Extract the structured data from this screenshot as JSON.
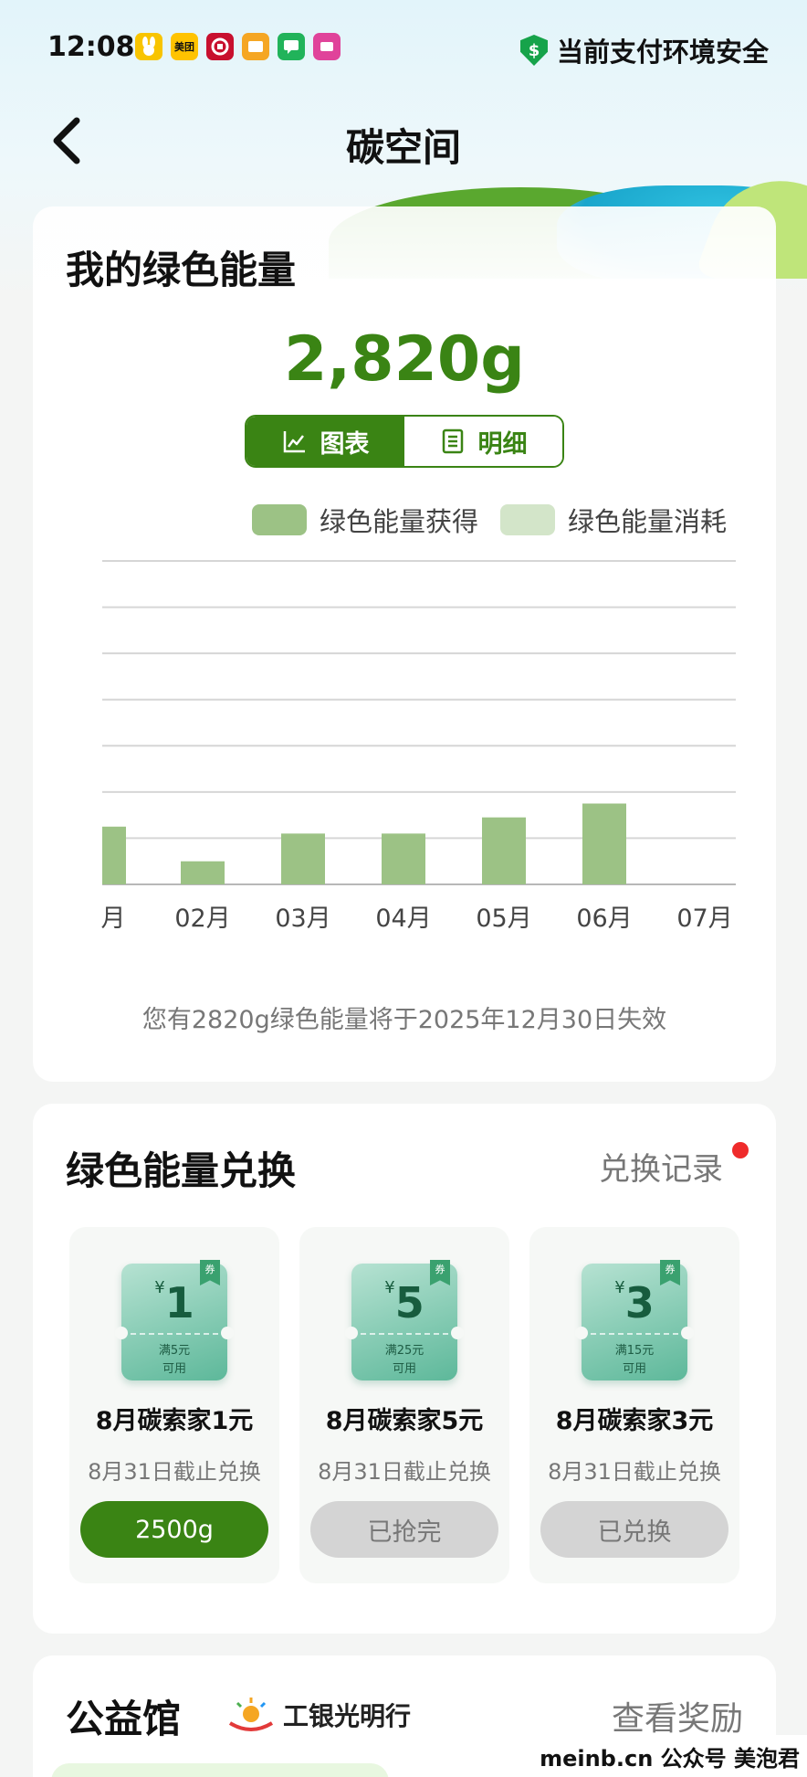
{
  "status_bar": {
    "time": "12:08",
    "app_icons": [
      {
        "name": "yellow-bunny-app-icon",
        "label": "",
        "color": "#f8c400"
      },
      {
        "name": "meituan-app-icon",
        "label": "美团",
        "color": "#ffc300"
      },
      {
        "name": "bank-app-icon",
        "label": "",
        "color": "#c8102e"
      },
      {
        "name": "orange-app-icon",
        "label": "",
        "color": "#f5a623"
      },
      {
        "name": "message-app-icon",
        "label": "",
        "color": "#21b35a"
      },
      {
        "name": "pink-app-icon",
        "label": "",
        "color": "#e0439a"
      }
    ],
    "security_text": "当前支付环境安全",
    "security_icon": "shield-dollar-icon"
  },
  "nav": {
    "title": "碳空间",
    "back_icon": "chevron-left-icon"
  },
  "energy_card": {
    "title": "我的绿色能量",
    "total": "2,820g",
    "tabs": [
      {
        "label": "图表",
        "icon": "line-chart-icon",
        "active": true
      },
      {
        "label": "明细",
        "icon": "list-icon",
        "active": false
      }
    ],
    "legend": [
      {
        "label": "绿色能量获得",
        "color": "#9cc285"
      },
      {
        "label": "绿色能量消耗",
        "color": "#d3e5c9"
      }
    ],
    "expiry_note": "您有2820g绿色能量将于2025年12月30日失效"
  },
  "chart_data": {
    "type": "bar",
    "categories": [
      "月",
      "02月",
      "03月",
      "04月",
      "05月",
      "06月",
      "07月"
    ],
    "series": [
      {
        "name": "绿色能量获得",
        "values": [
          5,
          2,
          4.4,
          4.4,
          5.8,
          7,
          0
        ]
      },
      {
        "name": "绿色能量消耗",
        "values": [
          0,
          0,
          0,
          0,
          0,
          0,
          0
        ]
      }
    ],
    "ylim": [
      0,
      28
    ],
    "gridlines": 8,
    "grid": true,
    "title": "",
    "xlabel": "",
    "ylabel": ""
  },
  "exchange_card": {
    "title": "绿色能量兑换",
    "record_link": "兑换记录",
    "coupons": [
      {
        "amount": "1",
        "yen": "¥",
        "tag": "券",
        "condition_line1": "满5元",
        "condition_line2": "可用",
        "name": "8月碳索家1元",
        "deadline": "8月31日截止兑换",
        "button": "2500g",
        "state": "available"
      },
      {
        "amount": "5",
        "yen": "¥",
        "tag": "券",
        "condition_line1": "满25元",
        "condition_line2": "可用",
        "name": "8月碳索家5元",
        "deadline": "8月31日截止兑换",
        "button": "已抢完",
        "state": "disabled"
      },
      {
        "amount": "3",
        "yen": "¥",
        "tag": "券",
        "condition_line1": "满15元",
        "condition_line2": "可用",
        "name": "8月碳索家3元",
        "deadline": "8月31日截止兑换",
        "button": "已兑换",
        "state": "disabled"
      }
    ]
  },
  "charity_card": {
    "title": "公益馆",
    "logo_text": "工银光明行",
    "reward_link": "查看奖励"
  },
  "watermark": "meinb.cn  公众号 美泡君",
  "colors": {
    "brand_green": "#3a8414",
    "bar_green": "#9cc285",
    "light_green": "#d3e5c9",
    "red_dot": "#ef2b2b"
  }
}
